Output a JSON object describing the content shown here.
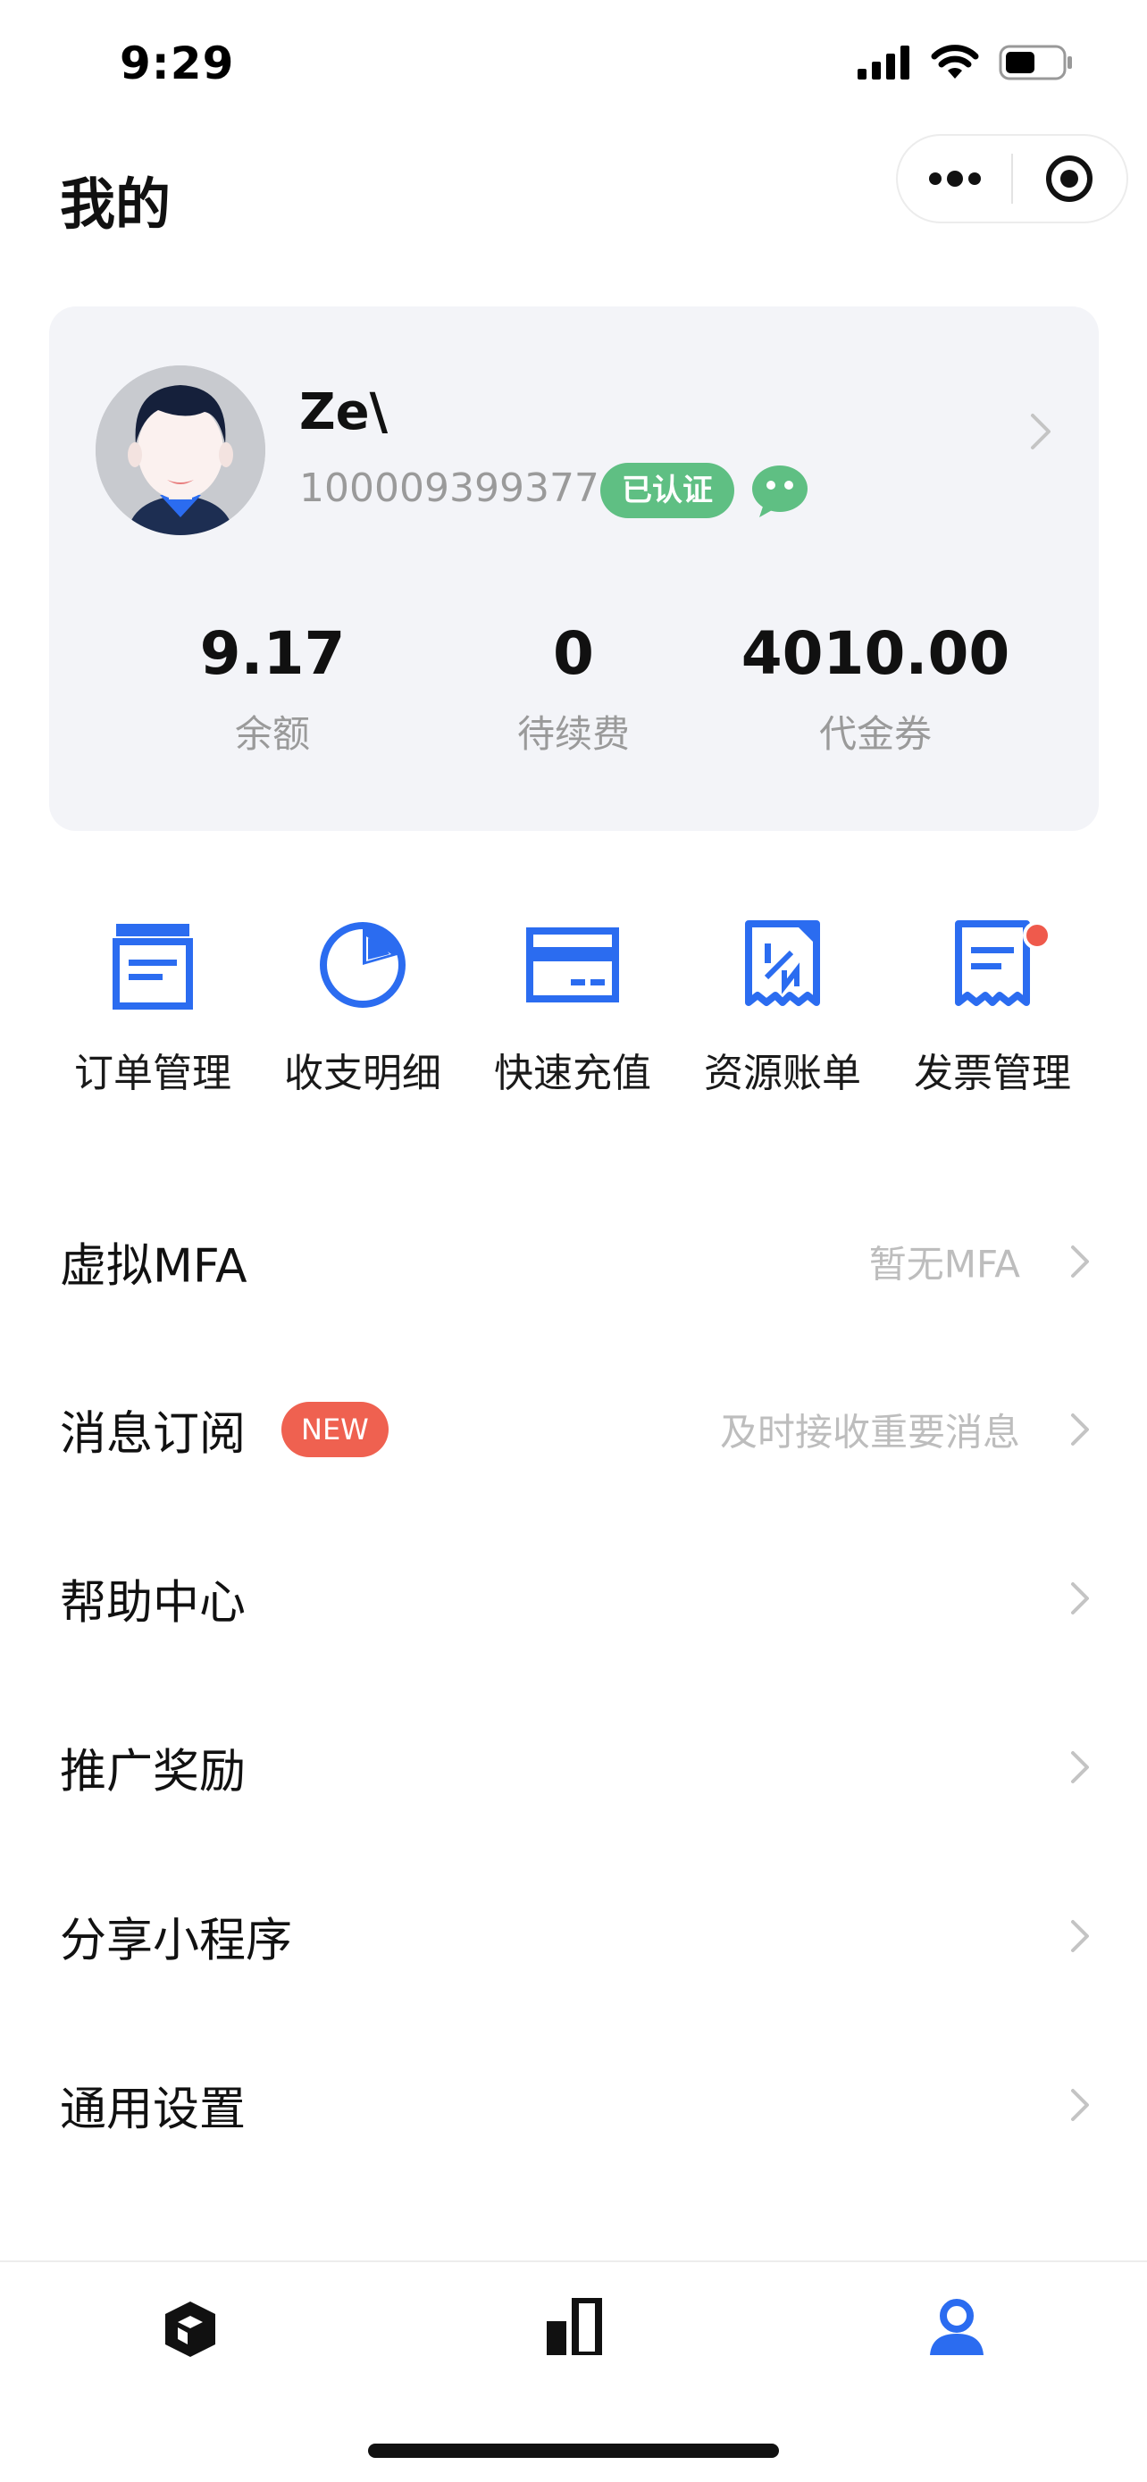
{
  "status_bar": {
    "time": "9:29"
  },
  "header": {
    "title": "我的"
  },
  "profile": {
    "username": "Ze\\",
    "user_id": "100009399377",
    "verified_badge": "已认证"
  },
  "stats": [
    {
      "value": "9.17",
      "label": "余额"
    },
    {
      "value": "0",
      "label": "待续费"
    },
    {
      "value": "4010.00",
      "label": "代金券"
    }
  ],
  "quick_actions": [
    {
      "label": "订单管理",
      "icon": "order-icon"
    },
    {
      "label": "收支明细",
      "icon": "pie-chart-icon"
    },
    {
      "label": "快速充值",
      "icon": "card-icon"
    },
    {
      "label": "资源账单",
      "icon": "receipt-icon"
    },
    {
      "label": "发票管理",
      "icon": "invoice-icon"
    }
  ],
  "menu": [
    {
      "label": "虚拟MFA",
      "hint": "暂无MFA"
    },
    {
      "label": "消息订阅",
      "badge": "NEW",
      "hint": "及时接收重要消息"
    },
    {
      "label": "帮助中心"
    },
    {
      "label": "推广奖励"
    },
    {
      "label": "分享小程序"
    },
    {
      "label": "通用设置"
    }
  ],
  "tabbar": [
    {
      "icon": "cube-icon",
      "active": false
    },
    {
      "icon": "bar-chart-icon",
      "active": false
    },
    {
      "icon": "user-icon",
      "active": true
    }
  ],
  "colors": {
    "accent": "#2b6cf0",
    "verified": "#5fbf83",
    "new_badge": "#ef6150",
    "card_bg": "#f3f4f8"
  }
}
